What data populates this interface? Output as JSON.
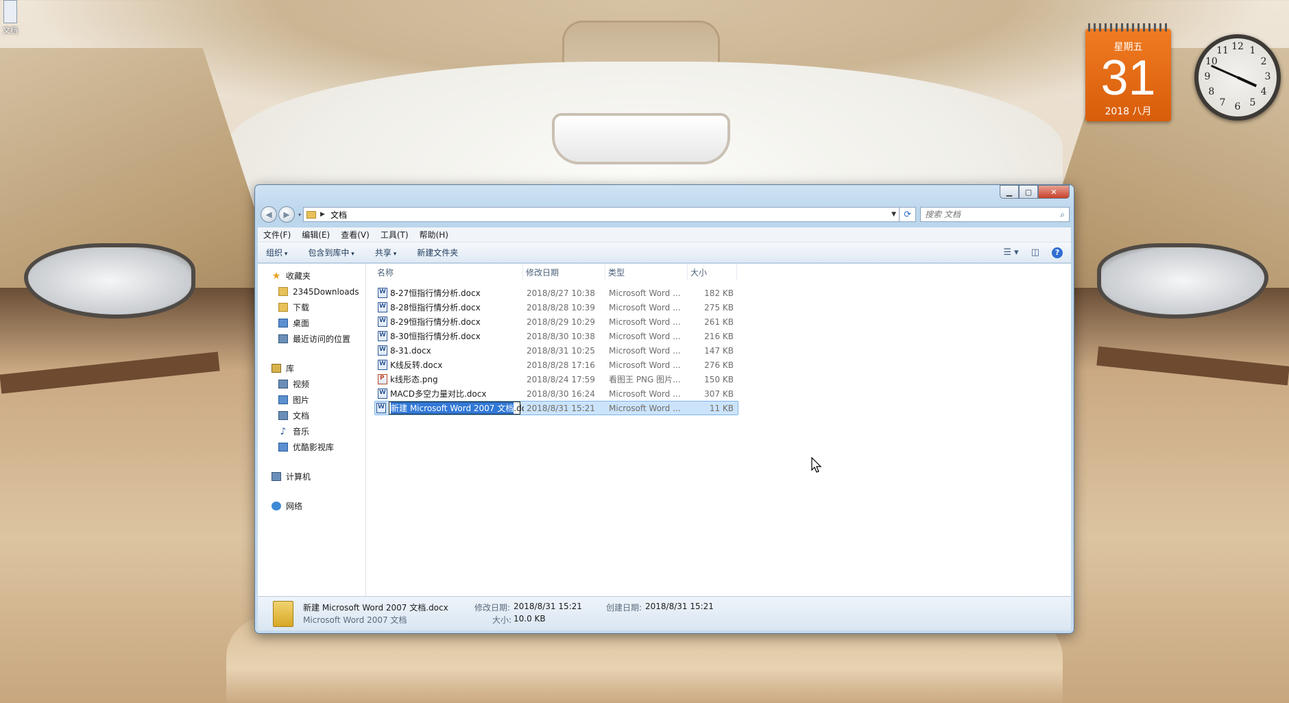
{
  "desktop": {
    "icon_label": "文档"
  },
  "calendar": {
    "weekday": "星期五",
    "day": "31",
    "year_month": "2018 八月"
  },
  "clock": {
    "numbers": [
      "12",
      "1",
      "2",
      "3",
      "4",
      "5",
      "6",
      "7",
      "8",
      "9",
      "10",
      "11"
    ],
    "hour": 3,
    "minute": 49
  },
  "window": {
    "address": {
      "path": "文档",
      "search_placeholder": "搜索 文档"
    },
    "menubar": [
      "文件(F)",
      "编辑(E)",
      "查看(V)",
      "工具(T)",
      "帮助(H)"
    ],
    "toolbar": {
      "organize": "组织",
      "include_library": "包含到库中",
      "share": "共享",
      "new_folder": "新建文件夹"
    },
    "nav": {
      "favorites": {
        "label": "收藏夹",
        "items": [
          "2345Downloads",
          "下载",
          "桌面",
          "最近访问的位置"
        ]
      },
      "libraries": {
        "label": "库",
        "items": [
          "视频",
          "图片",
          "文档",
          "音乐",
          "优酷影视库"
        ]
      },
      "computer": "计算机",
      "network": "网络"
    },
    "columns": {
      "name": "名称",
      "date": "修改日期",
      "type": "类型",
      "size": "大小"
    },
    "files": [
      {
        "name": "8-27恒指行情分析.docx",
        "date": "2018/8/27 10:38",
        "type": "Microsoft Word ...",
        "size": "182 KB",
        "icon": "word"
      },
      {
        "name": "8-28恒指行情分析.docx",
        "date": "2018/8/28 10:39",
        "type": "Microsoft Word ...",
        "size": "275 KB",
        "icon": "word"
      },
      {
        "name": "8-29恒指行情分析.docx",
        "date": "2018/8/29 10:29",
        "type": "Microsoft Word ...",
        "size": "261 KB",
        "icon": "word"
      },
      {
        "name": "8-30恒指行情分析.docx",
        "date": "2018/8/30 10:38",
        "type": "Microsoft Word ...",
        "size": "216 KB",
        "icon": "word"
      },
      {
        "name": "8-31.docx",
        "date": "2018/8/31 10:25",
        "type": "Microsoft Word ...",
        "size": "147 KB",
        "icon": "word"
      },
      {
        "name": "K线反转.docx",
        "date": "2018/8/28 17:16",
        "type": "Microsoft Word ...",
        "size": "276 KB",
        "icon": "word"
      },
      {
        "name": "k线形态.png",
        "date": "2018/8/24 17:59",
        "type": "看图王 PNG 图片...",
        "size": "150 KB",
        "icon": "png"
      },
      {
        "name": "MACD多空力量对比.docx",
        "date": "2018/8/30 16:24",
        "type": "Microsoft Word ...",
        "size": "307 KB",
        "icon": "word"
      }
    ],
    "renaming_file": {
      "name_selected": "新建 Microsoft Word 2007 文档",
      "extension": ".docx",
      "date": "2018/8/31 15:21",
      "type": "Microsoft Word ...",
      "size": "11 KB"
    },
    "details": {
      "filename": "新建 Microsoft Word 2007 文档.docx",
      "filetype": "Microsoft Word 2007 文档",
      "modified_label": "修改日期:",
      "modified_value": "2018/8/31 15:21",
      "size_label": "大小:",
      "size_value": "10.0 KB",
      "created_label": "创建日期:",
      "created_value": "2018/8/31 15:21"
    }
  }
}
